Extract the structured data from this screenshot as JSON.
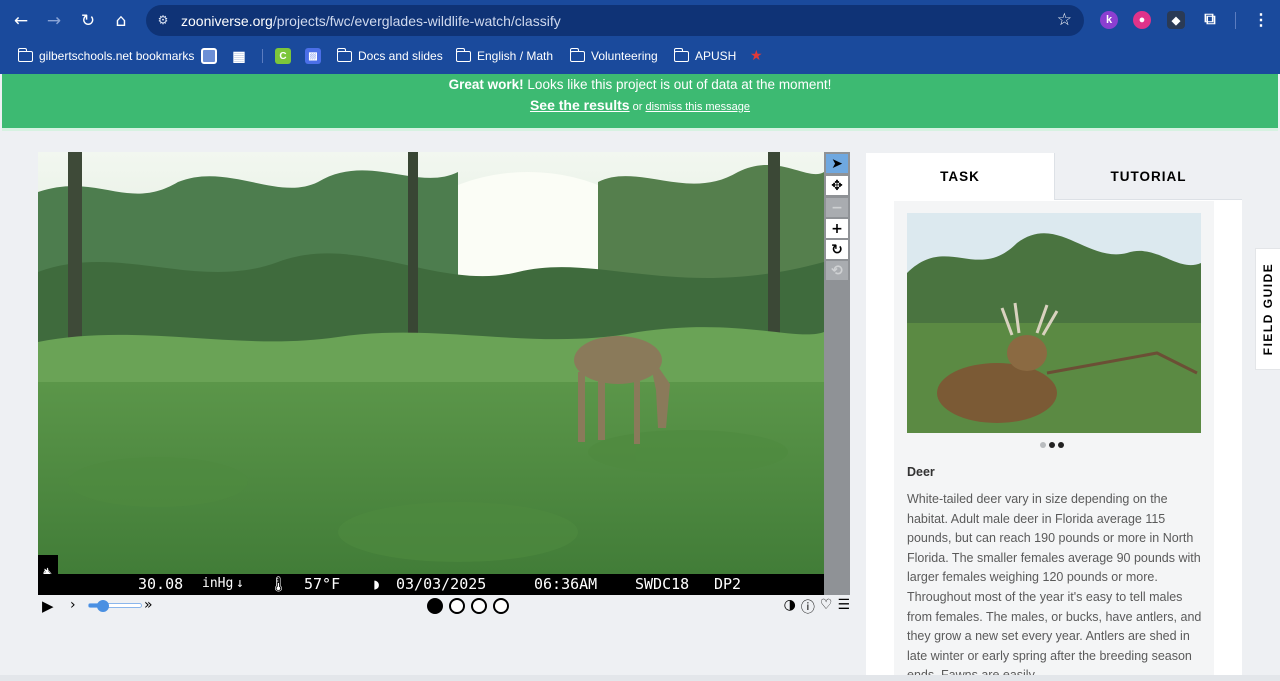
{
  "browser": {
    "url_host": "zooniverse.org",
    "url_path": "/projects/fwc/everglades-wildlife-watch/classify",
    "bookmarks": [
      {
        "label": "gilbertschools.net bookmarks"
      },
      {
        "label": "Docs and slides"
      },
      {
        "label": "English / Math"
      },
      {
        "label": "Volunteering"
      },
      {
        "label": "APUSH"
      }
    ],
    "extensions": [
      "k"
    ]
  },
  "banner": {
    "bold": "Great work!",
    "message": " Looks like this project is out of data at the moment!",
    "results_link": "See the results",
    "or_text": " or ",
    "dismiss_link": "dismiss this message",
    "color": "#3dba72"
  },
  "camera_strip": {
    "pressure": "30.08",
    "pressure_unit": "inHg",
    "pressure_trend": "↓",
    "temperature": "57°F",
    "date": "03/03/2025",
    "time": "06:36AM",
    "camera_id": "SWDC18",
    "unit_id": "DP2"
  },
  "viewer": {
    "frame_count": 4,
    "current_frame": 1,
    "playback_speed_fraction": 0.25,
    "tools": [
      "pointer-icon",
      "move-icon",
      "zoom-out-icon",
      "zoom-in-icon",
      "rotate-icon",
      "reset-icon"
    ]
  },
  "panel": {
    "tabs": {
      "task": "TASK",
      "tutorial": "TUTORIAL"
    },
    "animal_name": "Deer",
    "animal_description": "White-tailed deer vary in size depending on the habitat. Adult male deer in Florida average 115 pounds, but can reach 190 pounds or more in North Florida. The smaller females average 90 pounds with larger females weighing 120 pounds or more. Throughout most of the year it's easy to tell males from females. The males, or bucks, have antlers, and they grow a new set every year. Antlers are shed in late winter or early spring after the breeding season ends. Fawns are easily",
    "carousel_total": 3,
    "carousel_current": 2
  },
  "field_guide": "FIELD GUIDE"
}
